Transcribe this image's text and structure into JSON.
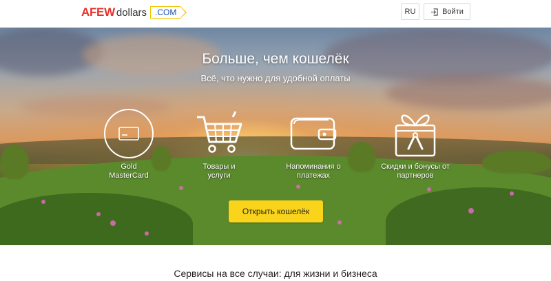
{
  "header": {
    "logo": {
      "afew": "AFEW",
      "dollars": "dollars",
      "com": ".COM"
    },
    "lang": "RU",
    "login": "Войти",
    "login_icon": "sign-in-icon"
  },
  "hero": {
    "title": "Больше, чем кошелёк",
    "subtitle": "Всё, что нужно для удобной оплаты",
    "features": [
      {
        "icon": "credit-card-icon",
        "label_line1": "Gold",
        "label_line2": "MasterCard"
      },
      {
        "icon": "shopping-cart-icon",
        "label_line1": "Товары и",
        "label_line2": "услуги"
      },
      {
        "icon": "wallet-icon",
        "label_line1": "Напоминания о",
        "label_line2": "платежах"
      },
      {
        "icon": "gift-icon",
        "label_line1": "Скидки и бонусы от",
        "label_line2": "партнеров"
      }
    ],
    "cta": "Открыть кошелёк"
  },
  "section": {
    "heading": "Сервисы на все случаи: для жизни и бизнеса"
  },
  "colors": {
    "brand_red": "#e8302a",
    "cta_yellow": "#f9d41a",
    "com_blue": "#1a4fb5"
  }
}
